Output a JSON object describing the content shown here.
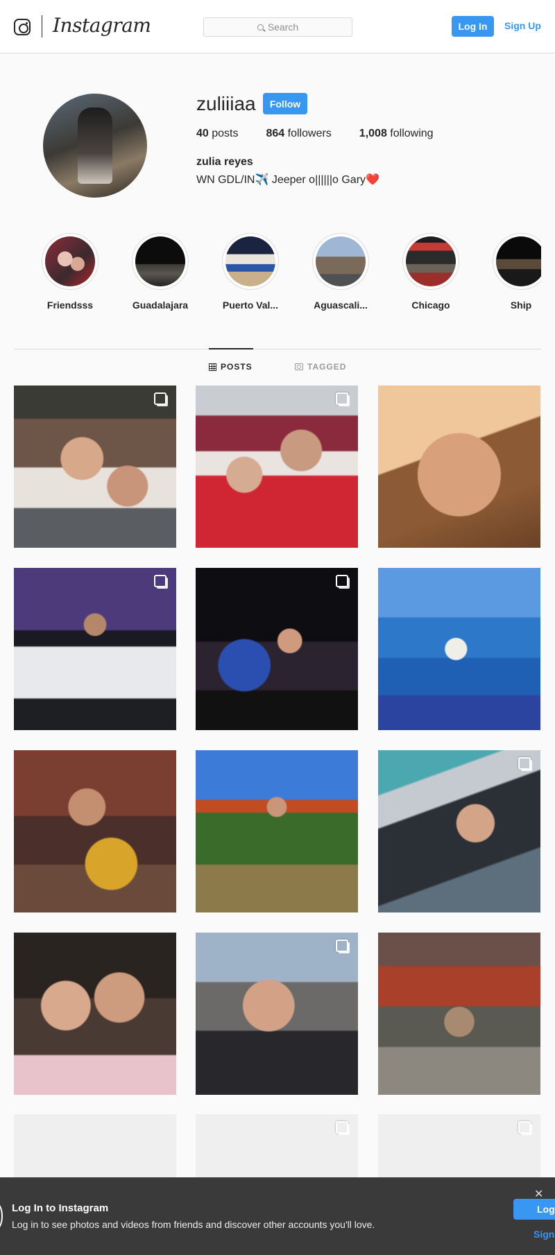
{
  "header": {
    "logo_wordmark": "Instagram",
    "search_placeholder": "Search",
    "login_label": "Log In",
    "signup_label": "Sign Up"
  },
  "profile": {
    "username": "zuliiiaa",
    "follow_label": "Follow",
    "posts_count": "40",
    "posts_label": "posts",
    "followers_count": "864",
    "followers_label": "followers",
    "following_count": "1,008",
    "following_label": "following",
    "full_name": "zulia reyes",
    "bio": "WN GDL/IN✈️ Jeeper o||||||o Gary❤️"
  },
  "highlights": [
    {
      "label": "Friendsss"
    },
    {
      "label": "Guadalajara"
    },
    {
      "label": "Puerto Val..."
    },
    {
      "label": "Aguascali..."
    },
    {
      "label": "Chicago"
    },
    {
      "label": "Ship"
    }
  ],
  "tabs": {
    "posts_label": "POSTS",
    "tagged_label": "TAGGED"
  },
  "posts": [
    {
      "multi": true
    },
    {
      "multi": true
    },
    {
      "multi": false
    },
    {
      "multi": true
    },
    {
      "multi": true
    },
    {
      "multi": false
    },
    {
      "multi": false
    },
    {
      "multi": false
    },
    {
      "multi": true
    },
    {
      "multi": false
    },
    {
      "multi": true
    },
    {
      "multi": false
    },
    {
      "multi": false
    },
    {
      "multi": true
    },
    {
      "multi": true
    }
  ],
  "login_banner": {
    "title": "Log In to Instagram",
    "text": "Log in to see photos and videos from friends and discover other accounts you'll love.",
    "login_label": "Log",
    "signup_label": "Sign",
    "close_label": "✕"
  },
  "colors": {
    "accent": "#3897f0",
    "text": "#262626",
    "border": "#dbdbdb",
    "banner_bg": "#3a3a3a"
  }
}
